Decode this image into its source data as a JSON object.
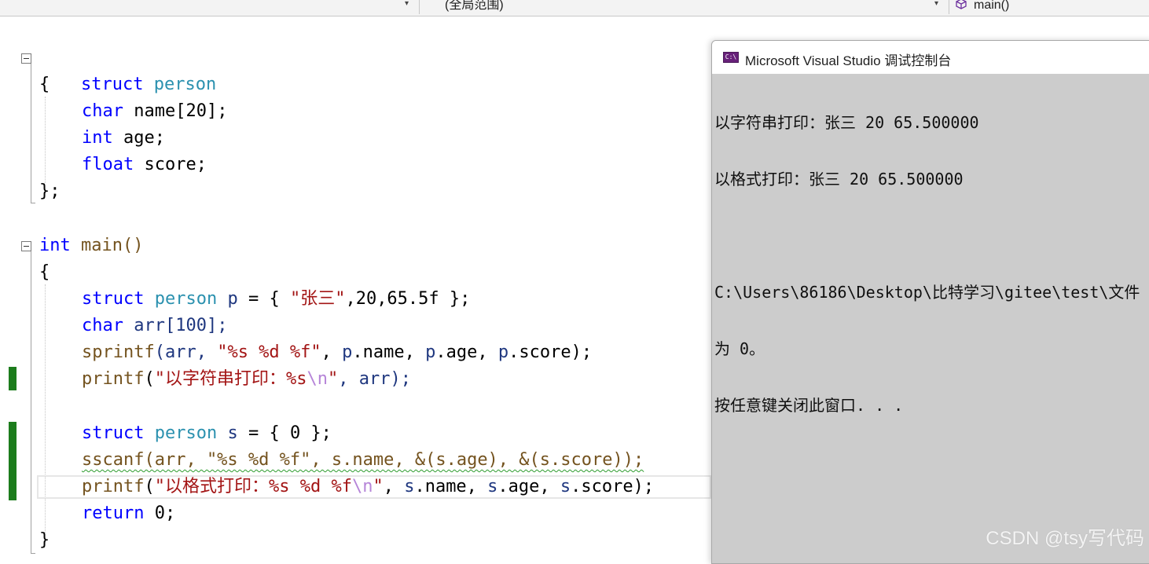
{
  "navbar": {
    "scope": "(全局范围)",
    "member": "main()"
  },
  "code": {
    "struct_def": {
      "kw_struct": "struct",
      "name": "person",
      "open": "{",
      "fields": [
        {
          "type": "char",
          "decl": " name[20];"
        },
        {
          "type": "int",
          "decl": " age;"
        },
        {
          "type": "float",
          "decl": " score;"
        }
      ],
      "close": "};"
    },
    "main": {
      "ret_type": "int",
      "sig": " main()",
      "open": "{",
      "line1": {
        "kw": "struct",
        "ty": "person",
        "var": " p",
        "rest1": " = { ",
        "str": "\"张三\"",
        "rest2": ",20,65.5f };"
      },
      "line2": {
        "kw": "char",
        "rest": " arr[100];"
      },
      "line3": {
        "fn": "sprintf",
        "p1": "(arr, ",
        "str": "\"%s %d %f\"",
        "p2": ", ",
        "v1": "p",
        "f1": ".name, ",
        "v2": "p",
        "f2": ".age, ",
        "v3": "p",
        "f3": ".score);"
      },
      "line4": {
        "fn": "printf",
        "p1": "(",
        "str": "\"以字符串打印：%s",
        "esc": "\\n",
        "str_end": "\"",
        "p2": ", arr);"
      },
      "line5": {
        "kw": "struct",
        "ty": "person",
        "var": " s",
        "rest": " = { 0 };"
      },
      "line6": {
        "text": "sscanf(arr, \"%s %d %f\", s.name, &(s.age), &(s.score));"
      },
      "line7": {
        "fn": "printf",
        "p1": "(",
        "str": "\"以格式打印：%s %d %f",
        "esc": "\\n",
        "str_end": "\"",
        "p2": ", ",
        "v1": "s",
        "f1": ".name, ",
        "v2": "s",
        "f2": ".age, ",
        "v3": "s",
        "f3": ".score);"
      },
      "line8": {
        "kw": "return",
        "rest": " 0;"
      },
      "close": "}"
    }
  },
  "console": {
    "title": "Microsoft Visual Studio 调试控制台",
    "icon_label": "C:\\",
    "lines": [
      "以字符串打印：张三 20 65.500000",
      "以格式打印：张三 20 65.500000",
      "",
      "C:\\Users\\86186\\Desktop\\比特学习\\gitee\\test\\文件",
      "为 0。",
      "按任意键关闭此窗口. . ."
    ]
  },
  "watermark": "CSDN @tsy写代码",
  "colors": {
    "keyword": "#0000ff",
    "type": "#2b91af",
    "string": "#a31515",
    "change_bar": "#1c7c1c",
    "console_bg": "#cccccc"
  }
}
